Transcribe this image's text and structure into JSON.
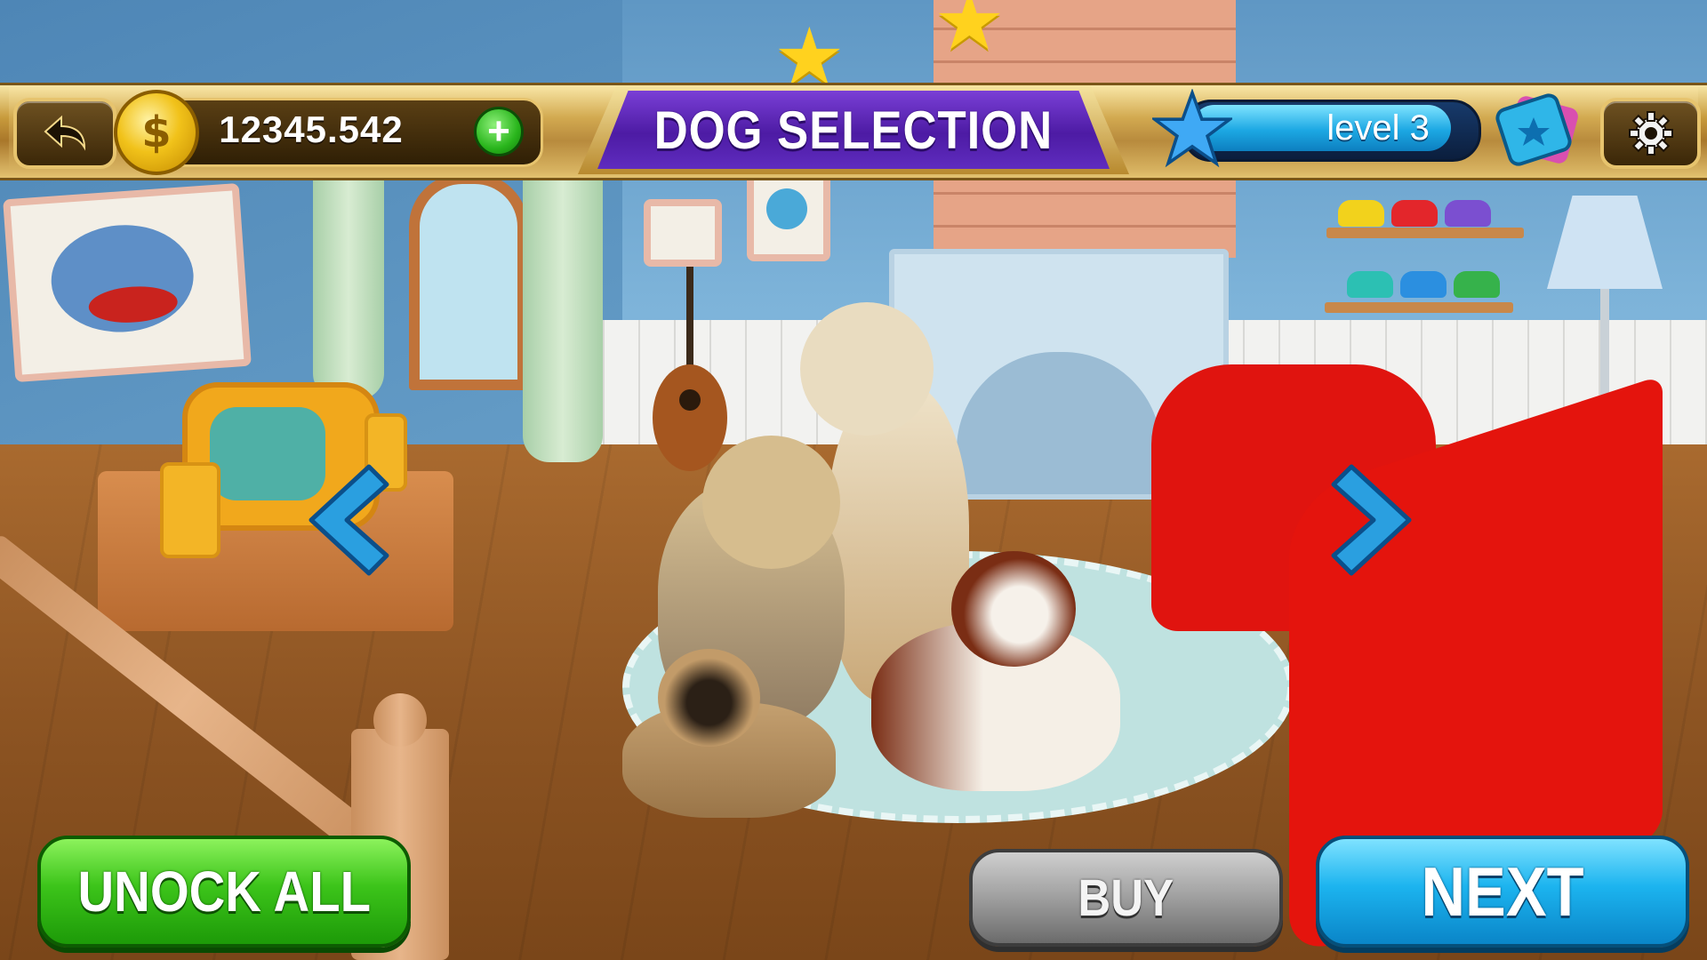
{
  "hud": {
    "back_icon": "back-arrow-icon",
    "coin_icon": "dollar-coin-icon",
    "coin_symbol": "$",
    "coins": "12345.542",
    "add_coins_symbol": "+",
    "title": "DOG SELECTION",
    "level_label": "level 3",
    "level_progress": 1.0,
    "ticket_icon": "ticket-icon",
    "settings_icon": "gear-icon"
  },
  "navigation": {
    "prev_icon": "chevron-left-icon",
    "next_icon": "chevron-right-icon"
  },
  "buttons": {
    "unlock_all": "UNOCK ALL",
    "buy": "BUY",
    "next": "NEXT"
  },
  "colors": {
    "unlock_green": "#3cc41a",
    "buy_gray": "#9a9a9a",
    "next_blue": "#1cb4ef",
    "title_purple": "#4d1ba4",
    "hud_gold": "#c89b3c"
  }
}
